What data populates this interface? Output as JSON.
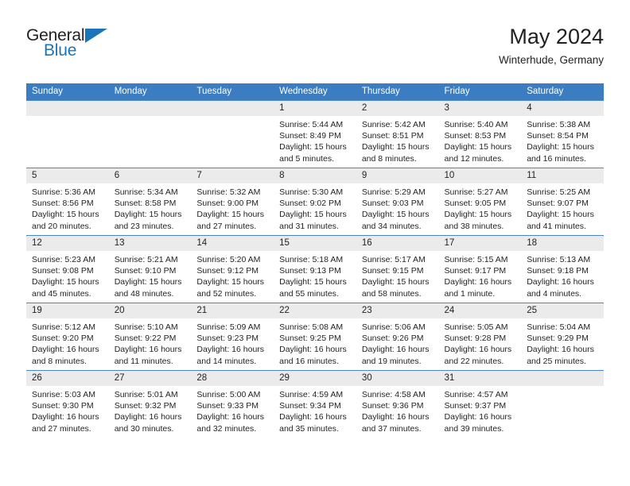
{
  "brand": {
    "name_part1": "General",
    "name_part2": "Blue",
    "triangle_icon": "triangle-icon",
    "accent_color": "#1b75bb"
  },
  "header": {
    "title": "May 2024",
    "subtitle": "Winterhude, Germany",
    "header_bg_color": "#3b7dc0",
    "daynum_bg_color": "#ebebeb"
  },
  "weekday_headers": [
    "Sunday",
    "Monday",
    "Tuesday",
    "Wednesday",
    "Thursday",
    "Friday",
    "Saturday"
  ],
  "labels": {
    "sunrise_prefix": "Sunrise:",
    "sunset_prefix": "Sunset:",
    "daylight_prefix": "Daylight:"
  },
  "weeks": [
    [
      {
        "day": "",
        "empty": true,
        "sunrise": "",
        "sunset": "",
        "daylight_line1": "",
        "daylight_line2": ""
      },
      {
        "day": "",
        "empty": true,
        "sunrise": "",
        "sunset": "",
        "daylight_line1": "",
        "daylight_line2": ""
      },
      {
        "day": "",
        "empty": true,
        "sunrise": "",
        "sunset": "",
        "daylight_line1": "",
        "daylight_line2": ""
      },
      {
        "day": "1",
        "empty": false,
        "sunrise": "Sunrise: 5:44 AM",
        "sunset": "Sunset: 8:49 PM",
        "daylight_line1": "Daylight: 15 hours",
        "daylight_line2": "and 5 minutes."
      },
      {
        "day": "2",
        "empty": false,
        "sunrise": "Sunrise: 5:42 AM",
        "sunset": "Sunset: 8:51 PM",
        "daylight_line1": "Daylight: 15 hours",
        "daylight_line2": "and 8 minutes."
      },
      {
        "day": "3",
        "empty": false,
        "sunrise": "Sunrise: 5:40 AM",
        "sunset": "Sunset: 8:53 PM",
        "daylight_line1": "Daylight: 15 hours",
        "daylight_line2": "and 12 minutes."
      },
      {
        "day": "4",
        "empty": false,
        "sunrise": "Sunrise: 5:38 AM",
        "sunset": "Sunset: 8:54 PM",
        "daylight_line1": "Daylight: 15 hours",
        "daylight_line2": "and 16 minutes."
      }
    ],
    [
      {
        "day": "5",
        "empty": false,
        "sunrise": "Sunrise: 5:36 AM",
        "sunset": "Sunset: 8:56 PM",
        "daylight_line1": "Daylight: 15 hours",
        "daylight_line2": "and 20 minutes."
      },
      {
        "day": "6",
        "empty": false,
        "sunrise": "Sunrise: 5:34 AM",
        "sunset": "Sunset: 8:58 PM",
        "daylight_line1": "Daylight: 15 hours",
        "daylight_line2": "and 23 minutes."
      },
      {
        "day": "7",
        "empty": false,
        "sunrise": "Sunrise: 5:32 AM",
        "sunset": "Sunset: 9:00 PM",
        "daylight_line1": "Daylight: 15 hours",
        "daylight_line2": "and 27 minutes."
      },
      {
        "day": "8",
        "empty": false,
        "sunrise": "Sunrise: 5:30 AM",
        "sunset": "Sunset: 9:02 PM",
        "daylight_line1": "Daylight: 15 hours",
        "daylight_line2": "and 31 minutes."
      },
      {
        "day": "9",
        "empty": false,
        "sunrise": "Sunrise: 5:29 AM",
        "sunset": "Sunset: 9:03 PM",
        "daylight_line1": "Daylight: 15 hours",
        "daylight_line2": "and 34 minutes."
      },
      {
        "day": "10",
        "empty": false,
        "sunrise": "Sunrise: 5:27 AM",
        "sunset": "Sunset: 9:05 PM",
        "daylight_line1": "Daylight: 15 hours",
        "daylight_line2": "and 38 minutes."
      },
      {
        "day": "11",
        "empty": false,
        "sunrise": "Sunrise: 5:25 AM",
        "sunset": "Sunset: 9:07 PM",
        "daylight_line1": "Daylight: 15 hours",
        "daylight_line2": "and 41 minutes."
      }
    ],
    [
      {
        "day": "12",
        "empty": false,
        "sunrise": "Sunrise: 5:23 AM",
        "sunset": "Sunset: 9:08 PM",
        "daylight_line1": "Daylight: 15 hours",
        "daylight_line2": "and 45 minutes."
      },
      {
        "day": "13",
        "empty": false,
        "sunrise": "Sunrise: 5:21 AM",
        "sunset": "Sunset: 9:10 PM",
        "daylight_line1": "Daylight: 15 hours",
        "daylight_line2": "and 48 minutes."
      },
      {
        "day": "14",
        "empty": false,
        "sunrise": "Sunrise: 5:20 AM",
        "sunset": "Sunset: 9:12 PM",
        "daylight_line1": "Daylight: 15 hours",
        "daylight_line2": "and 52 minutes."
      },
      {
        "day": "15",
        "empty": false,
        "sunrise": "Sunrise: 5:18 AM",
        "sunset": "Sunset: 9:13 PM",
        "daylight_line1": "Daylight: 15 hours",
        "daylight_line2": "and 55 minutes."
      },
      {
        "day": "16",
        "empty": false,
        "sunrise": "Sunrise: 5:17 AM",
        "sunset": "Sunset: 9:15 PM",
        "daylight_line1": "Daylight: 15 hours",
        "daylight_line2": "and 58 minutes."
      },
      {
        "day": "17",
        "empty": false,
        "sunrise": "Sunrise: 5:15 AM",
        "sunset": "Sunset: 9:17 PM",
        "daylight_line1": "Daylight: 16 hours",
        "daylight_line2": "and 1 minute."
      },
      {
        "day": "18",
        "empty": false,
        "sunrise": "Sunrise: 5:13 AM",
        "sunset": "Sunset: 9:18 PM",
        "daylight_line1": "Daylight: 16 hours",
        "daylight_line2": "and 4 minutes."
      }
    ],
    [
      {
        "day": "19",
        "empty": false,
        "sunrise": "Sunrise: 5:12 AM",
        "sunset": "Sunset: 9:20 PM",
        "daylight_line1": "Daylight: 16 hours",
        "daylight_line2": "and 8 minutes."
      },
      {
        "day": "20",
        "empty": false,
        "sunrise": "Sunrise: 5:10 AM",
        "sunset": "Sunset: 9:22 PM",
        "daylight_line1": "Daylight: 16 hours",
        "daylight_line2": "and 11 minutes."
      },
      {
        "day": "21",
        "empty": false,
        "sunrise": "Sunrise: 5:09 AM",
        "sunset": "Sunset: 9:23 PM",
        "daylight_line1": "Daylight: 16 hours",
        "daylight_line2": "and 14 minutes."
      },
      {
        "day": "22",
        "empty": false,
        "sunrise": "Sunrise: 5:08 AM",
        "sunset": "Sunset: 9:25 PM",
        "daylight_line1": "Daylight: 16 hours",
        "daylight_line2": "and 16 minutes."
      },
      {
        "day": "23",
        "empty": false,
        "sunrise": "Sunrise: 5:06 AM",
        "sunset": "Sunset: 9:26 PM",
        "daylight_line1": "Daylight: 16 hours",
        "daylight_line2": "and 19 minutes."
      },
      {
        "day": "24",
        "empty": false,
        "sunrise": "Sunrise: 5:05 AM",
        "sunset": "Sunset: 9:28 PM",
        "daylight_line1": "Daylight: 16 hours",
        "daylight_line2": "and 22 minutes."
      },
      {
        "day": "25",
        "empty": false,
        "sunrise": "Sunrise: 5:04 AM",
        "sunset": "Sunset: 9:29 PM",
        "daylight_line1": "Daylight: 16 hours",
        "daylight_line2": "and 25 minutes."
      }
    ],
    [
      {
        "day": "26",
        "empty": false,
        "sunrise": "Sunrise: 5:03 AM",
        "sunset": "Sunset: 9:30 PM",
        "daylight_line1": "Daylight: 16 hours",
        "daylight_line2": "and 27 minutes."
      },
      {
        "day": "27",
        "empty": false,
        "sunrise": "Sunrise: 5:01 AM",
        "sunset": "Sunset: 9:32 PM",
        "daylight_line1": "Daylight: 16 hours",
        "daylight_line2": "and 30 minutes."
      },
      {
        "day": "28",
        "empty": false,
        "sunrise": "Sunrise: 5:00 AM",
        "sunset": "Sunset: 9:33 PM",
        "daylight_line1": "Daylight: 16 hours",
        "daylight_line2": "and 32 minutes."
      },
      {
        "day": "29",
        "empty": false,
        "sunrise": "Sunrise: 4:59 AM",
        "sunset": "Sunset: 9:34 PM",
        "daylight_line1": "Daylight: 16 hours",
        "daylight_line2": "and 35 minutes."
      },
      {
        "day": "30",
        "empty": false,
        "sunrise": "Sunrise: 4:58 AM",
        "sunset": "Sunset: 9:36 PM",
        "daylight_line1": "Daylight: 16 hours",
        "daylight_line2": "and 37 minutes."
      },
      {
        "day": "31",
        "empty": false,
        "sunrise": "Sunrise: 4:57 AM",
        "sunset": "Sunset: 9:37 PM",
        "daylight_line1": "Daylight: 16 hours",
        "daylight_line2": "and 39 minutes."
      },
      {
        "day": "",
        "empty": true,
        "sunrise": "",
        "sunset": "",
        "daylight_line1": "",
        "daylight_line2": ""
      }
    ]
  ]
}
